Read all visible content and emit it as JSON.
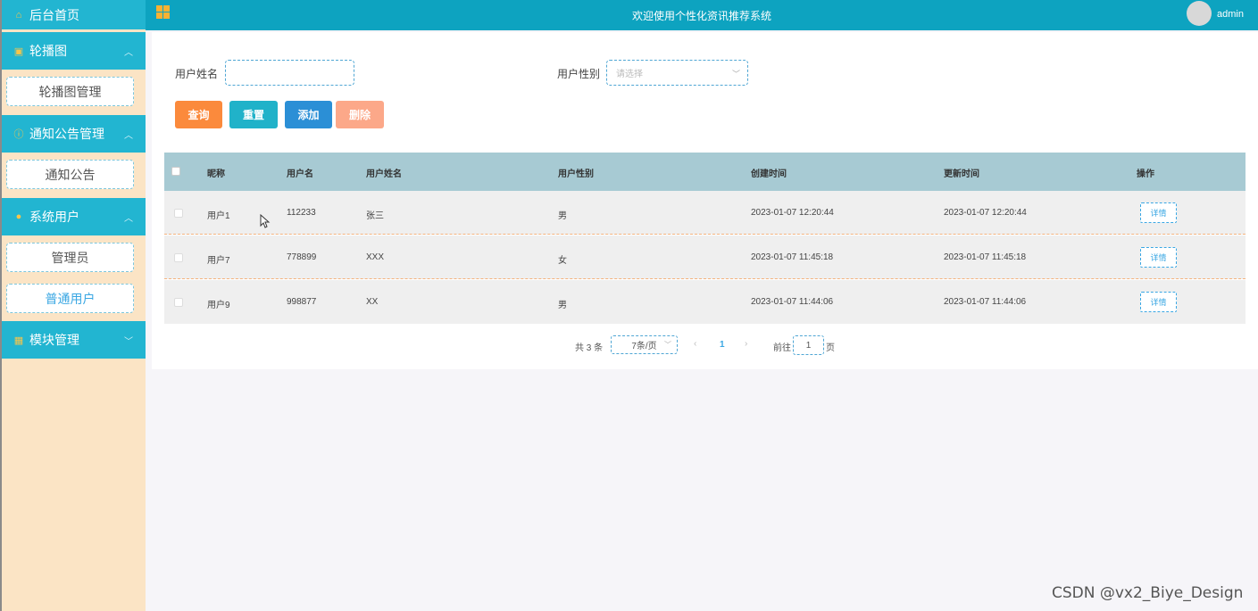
{
  "sidebar": {
    "home": {
      "label": "后台首页",
      "icon": "home-icon"
    },
    "sections": [
      {
        "label": "轮播图",
        "icon": "image-icon",
        "arrow": "︿",
        "items": [
          {
            "label": "轮播图管理",
            "active": false
          }
        ]
      },
      {
        "label": "通知公告管理",
        "icon": "info-icon",
        "arrow": "︿",
        "items": [
          {
            "label": "通知公告",
            "active": false
          }
        ]
      },
      {
        "label": "系统用户",
        "icon": "user-icon",
        "arrow": "︿",
        "items": [
          {
            "label": "管理员",
            "active": false
          },
          {
            "label": "普通用户",
            "active": true
          }
        ]
      },
      {
        "label": "模块管理",
        "icon": "grid-icon",
        "arrow": "﹀",
        "items": []
      }
    ]
  },
  "header": {
    "title": "欢迎使用个性化资讯推荐系统",
    "username": "admin"
  },
  "search": {
    "name_label": "用户姓名",
    "name_value": "",
    "gender_label": "用户性别",
    "gender_placeholder": "请选择"
  },
  "actions": {
    "query": "查询",
    "reset": "重置",
    "add": "添加",
    "delete": "删除"
  },
  "table": {
    "columns": [
      "昵称",
      "用户名",
      "用户姓名",
      "用户性别",
      "创建时间",
      "更新时间",
      "操作"
    ],
    "rows": [
      {
        "nickname": "用户1",
        "username": "112233",
        "realname": "张三",
        "gender": "男",
        "created": "2023-01-07 12:20:44",
        "updated": "2023-01-07 12:20:44",
        "action": "详情"
      },
      {
        "nickname": "用户7",
        "username": "778899",
        "realname": "XXX",
        "gender": "女",
        "created": "2023-01-07 11:45:18",
        "updated": "2023-01-07 11:45:18",
        "action": "详情"
      },
      {
        "nickname": "用户9",
        "username": "998877",
        "realname": "XX",
        "gender": "男",
        "created": "2023-01-07 11:44:06",
        "updated": "2023-01-07 11:44:06",
        "action": "详情"
      }
    ]
  },
  "pagination": {
    "total": "共 3 条",
    "page_size": "7条/页",
    "prev": "‹",
    "current": "1",
    "next": "›",
    "goto_label": "前往",
    "goto_value": "1",
    "goto_suffix": "页"
  },
  "watermark": "CSDN @vx2_Biye_Design",
  "colors": {
    "topbar": "#0da3c0",
    "sidebar_bg": "#fbe4c5",
    "nav_head": "#22b5d1",
    "query": "#fb8a3c",
    "reset": "#20b2c9",
    "add": "#2b8fd6",
    "delete": "#fca889"
  }
}
